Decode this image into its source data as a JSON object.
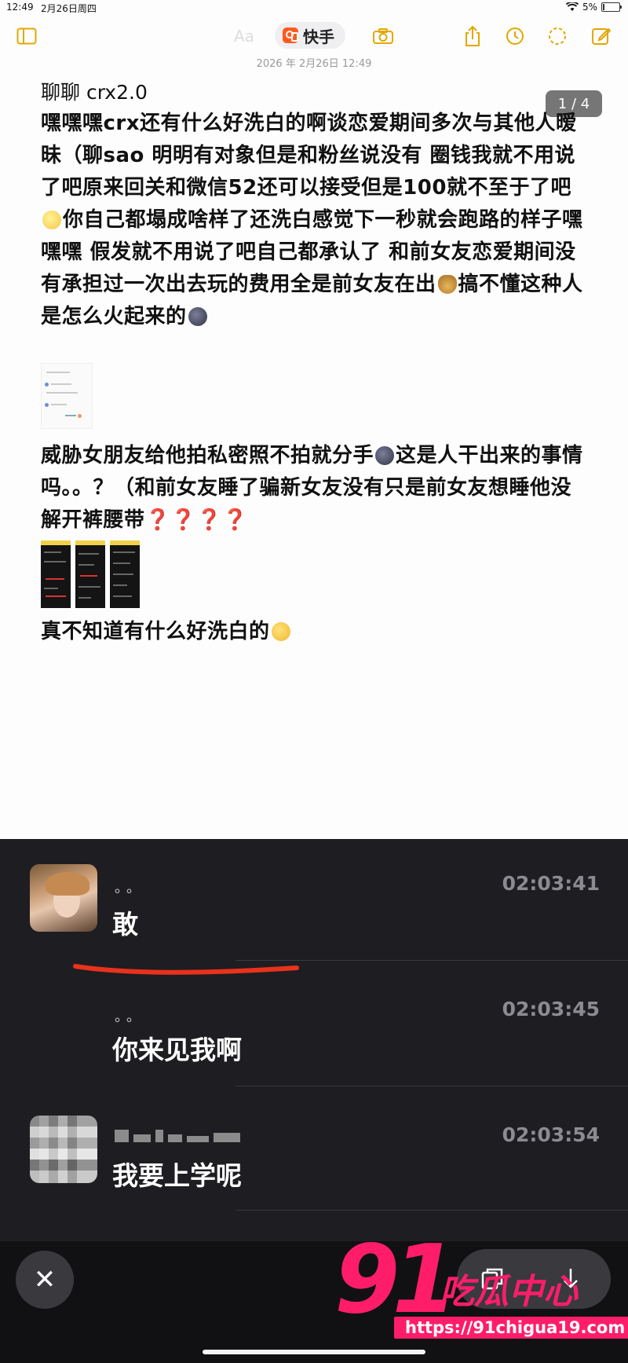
{
  "status_bar": {
    "time": "12:49",
    "date": "2月26日周四",
    "battery": "5%"
  },
  "toolbar": {
    "ghost_text": "Aa",
    "app_name": "快手"
  },
  "note": {
    "date": "2026 年 2月26日 12:49",
    "page_badge": "1 / 4",
    "title": "聊聊 crx2.0",
    "para1_a": "嘿嘿嘿crx还有什么好洗白的啊谈恋爱期间多次与其他人暧昧（聊sao 明明有对象但是和粉丝说没有 圈钱我就不用说了吧原来回关和微信52还可以接受但是100就不至于了吧",
    "para1_b": "你自己都塌成啥样了还洗白感觉下一秒就会跑路的样子嘿嘿嘿 假发就不用说了吧自己都承认了 和前女友恋爱期间没有承担过一次出去玩的费用全是前女友在出",
    "para1_c": "搞不懂这种人是怎么火起来的",
    "para2_a": "威胁女朋友给他拍私密照不拍就分手",
    "para2_b": "这是人干出来的事情吗。。？（和前女友睡了骗新女友没有只是前女友想睡他没解开裤腰带",
    "para2_q": "❓❓❓❓",
    "para3": "真不知道有什么好洗白的"
  },
  "chat": {
    "messages": [
      {
        "sender": "。。",
        "time": "02:03:41",
        "text": "敢"
      },
      {
        "sender": "。。",
        "time": "02:03:45",
        "text": "你来见我啊"
      },
      {
        "sender": "",
        "time": "02:03:54",
        "text": "我要上学呢"
      }
    ]
  },
  "viewer": {
    "close": "✕"
  },
  "watermark": {
    "number": "91",
    "name": "吃瓜中心",
    "url": "https://91chigua19.com"
  },
  "colors": {
    "accent": "#e4a700",
    "kuaishou": "#ff5a1f",
    "watermark": "#ff1d6a",
    "dark_bg": "#1e1d21"
  }
}
